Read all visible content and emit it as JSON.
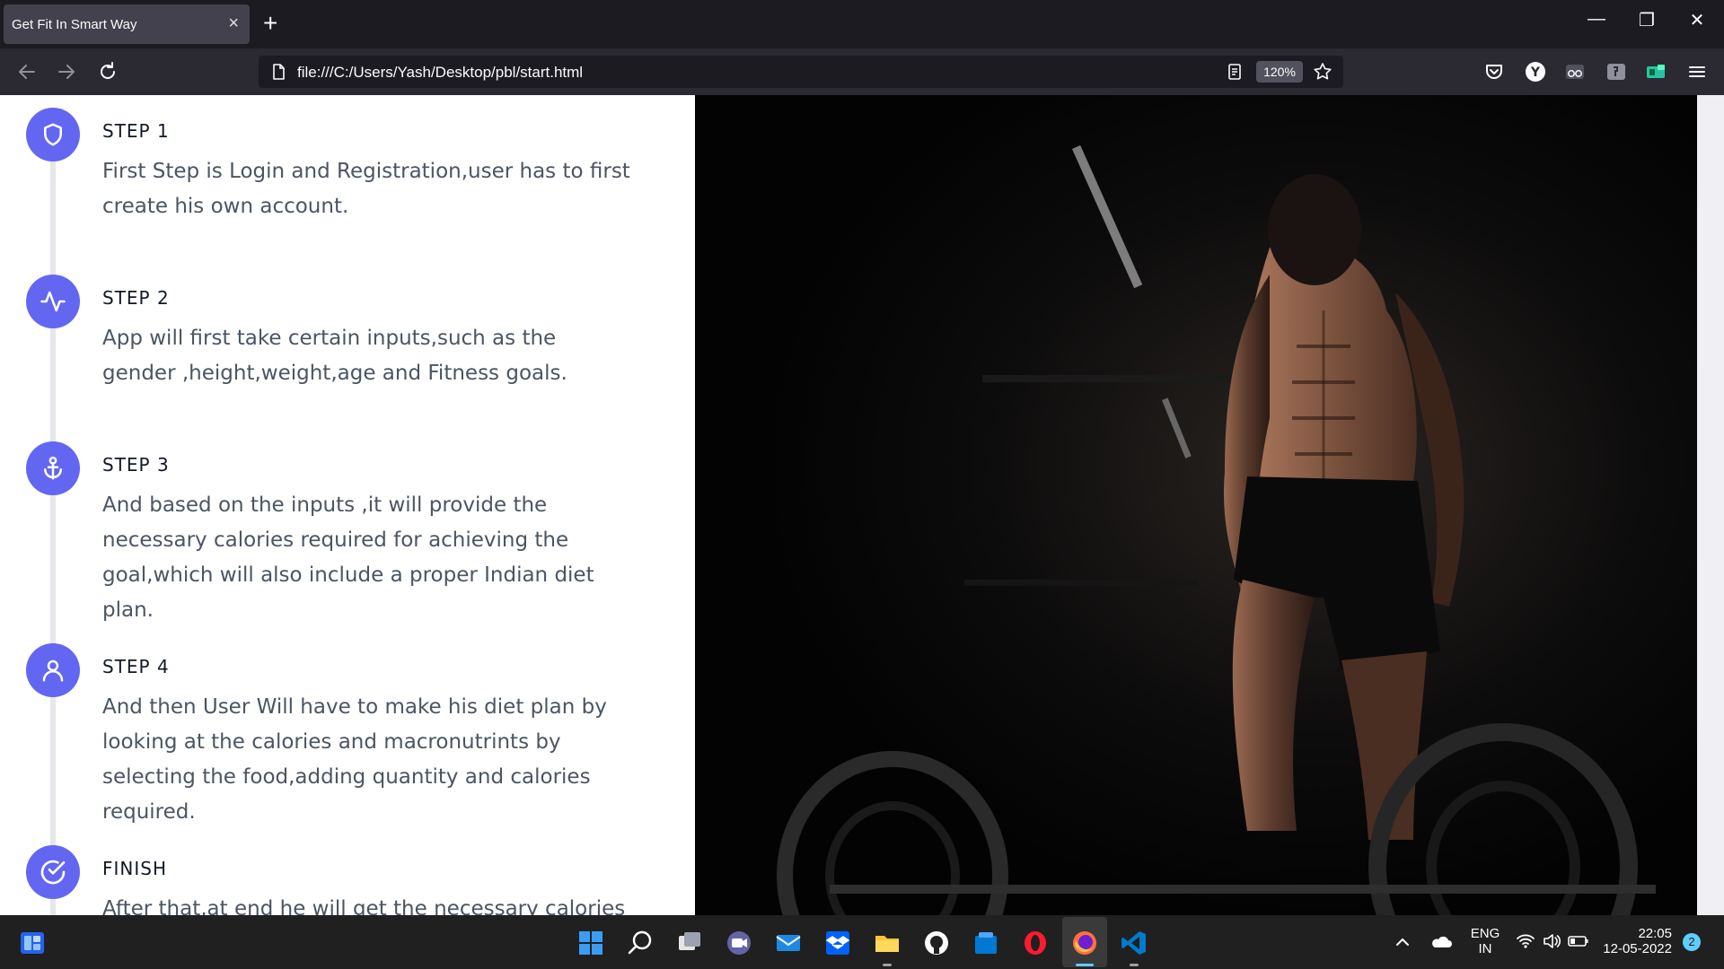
{
  "browser": {
    "tab_title": "Get Fit In Smart Way",
    "tab_close": "×",
    "new_tab": "+",
    "url": "file:///C:/Users/Yash/Desktop/pbl/start.html",
    "zoom": "120%",
    "window_controls": {
      "minimize": "—",
      "restore": "❐",
      "close": "✕"
    }
  },
  "steps": [
    {
      "icon": "shield-icon",
      "title": "STEP 1",
      "text": "First Step is Login and Registration,user has to first create his own account."
    },
    {
      "icon": "pulse-icon",
      "title": "STEP 2",
      "text": "App will first take certain inputs,such as the gender ,height,weight,age and Fitness goals."
    },
    {
      "icon": "anchor-icon",
      "title": "STEP 3",
      "text": "And based on the inputs ,it will provide the necessary calories required for achieving the goal,which will also include a proper Indian diet plan."
    },
    {
      "icon": "user-icon",
      "title": "STEP 4",
      "text": "And then User Will have to make his diet plan by looking at the calories and macronutrints by selecting the food,adding quantity and calories required."
    },
    {
      "icon": "check-circle-icon",
      "title": "FINISH",
      "text": "After that,at end he will get the necessary calories he"
    }
  ],
  "colors": {
    "accent": "#6366f1",
    "browser_bg": "#1c1b22",
    "toolbar_bg": "#2b2a33",
    "taskbar_bg": "#202020"
  },
  "taskbar": {
    "language_line1": "ENG",
    "language_line2": "IN",
    "time": "22:05",
    "date": "12-05-2022",
    "notification_count": "2"
  }
}
